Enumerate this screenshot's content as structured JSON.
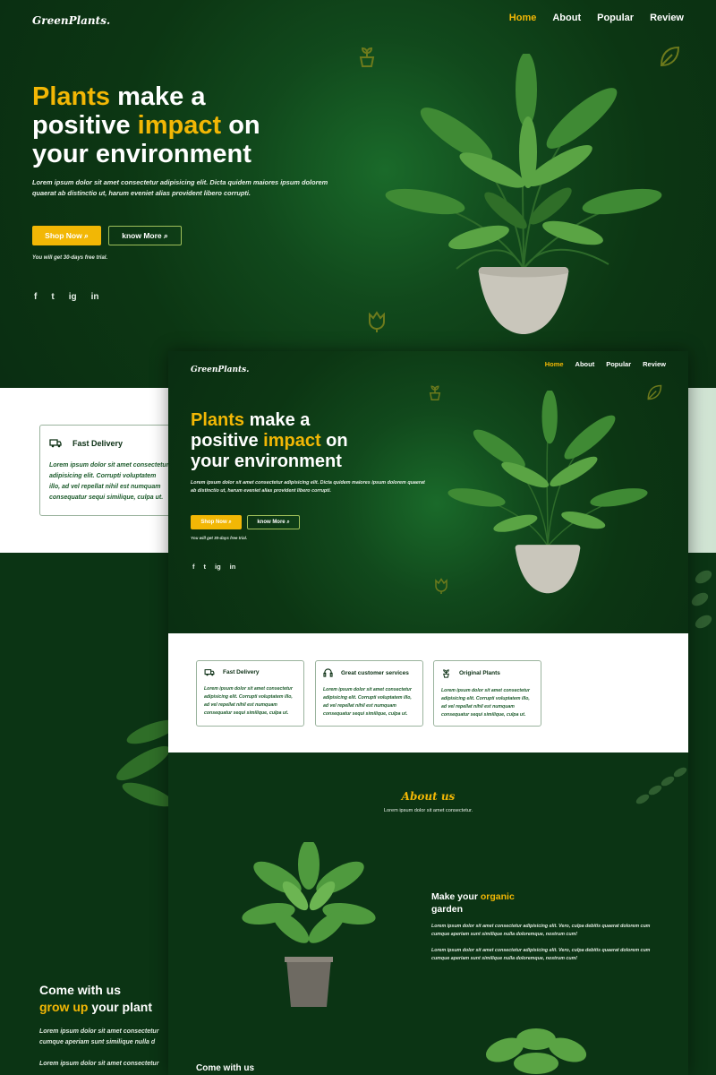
{
  "brand": "GreenPlants.",
  "nav": {
    "home": "Home",
    "about": "About",
    "popular": "Popular",
    "review": "Review"
  },
  "hero": {
    "h_w1": "Plants",
    "h_w2": " make a",
    "h_w3": "positive ",
    "h_w4": "impact",
    "h_w5": " on",
    "h_w6": "your environment",
    "paragraph": "Lorem ipsum dolor sit amet consectetur adipisicing elit. Dicta quidem maiores ipsum dolorem quaerat ab distinctio ut, harum eveniet alias provident libero corrupti.",
    "shop_button": "Shop Now",
    "know_button": "know More",
    "trial_note": "You will get 30-days free trial."
  },
  "features": [
    {
      "title": "Fast Delivery",
      "icon": "truck-icon",
      "text": "Lorem ipsum dolor sit amet consectetur adipisicing elit. Corrupti voluptatem illo, ad vel repellat nihil est numquam consequatur sequi similique, culpa ut."
    },
    {
      "title": "Great customer services",
      "icon": "headset-icon",
      "text": "Lorem ipsum dolor sit amet consectetur adipisicing elit. Corrupti voluptatem illo, ad vel repellat nihil est numquam consequatur sequi similique, culpa ut."
    },
    {
      "title": "Original Plants",
      "icon": "sprout-icon",
      "text": "Lorem ipsum dolor sit amet consectetur adipisicing elit. Corrupti voluptatem illo, ad vel repellat nihil est numquam consequatur sequi similique, culpa ut."
    }
  ],
  "bg_card_lines": [
    "Lorem ipsum dolor sit amet consectetur",
    "adipisicing elit. Corrupti voluptatem",
    "illo, ad vel repellat nihil est numquam",
    "consequatur sequi similique, culpa ut."
  ],
  "about": {
    "title": "About us",
    "subtitle": "Lorem ipsum dolor sit amet consectetur.",
    "make_w1": "Make your ",
    "make_w2": "organic",
    "make_w3": "garden",
    "p1": "Lorem ipsum dolor sit amet consectetur adipisicing elit. Vero, culpa debitis quaerat dolorem cum cumque aperiam sunt similique nulla doloremque, nostrum cum!",
    "p2": "Lorem ipsum dolor sit amet consectetur adipisicing elit. Vero, culpa debitis quaerat dolorem cum cumque aperiam sunt similique nulla doloremque, nostrum cum!"
  },
  "come": {
    "w1": "Come with us",
    "w2": "grow up",
    "w3": " your plant",
    "line1": "Lorem ipsum dolor sit amet consectetur",
    "line2": "cumque aperiam sunt similique nulla d",
    "line3": "Lorem ipsum dolor sit amet consectetur"
  },
  "social": {
    "facebook": "f",
    "twitter": "t",
    "instagram": "ig",
    "linkedin": "in"
  },
  "colors": {
    "dark_green": "#0a2e12",
    "accent": "#f2b705",
    "card_border": "#9ab39d"
  }
}
